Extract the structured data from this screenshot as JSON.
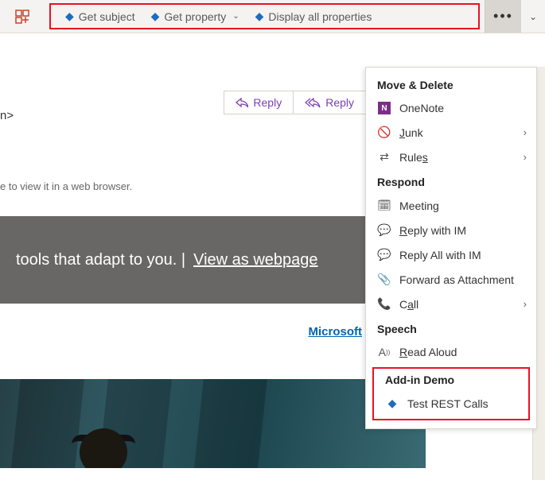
{
  "toolbar": {
    "btn1": "Get subject",
    "btn2": "Get property",
    "btn3": "Display all properties"
  },
  "message": {
    "sender_suffix": "n>",
    "hint": "e to view it in a web browser.",
    "banner_text": "tools that adapt to you. | ",
    "banner_link": "View as webpage",
    "ms_link": "Microsoft"
  },
  "reply": {
    "reply": "Reply",
    "reply_all": "Reply"
  },
  "menu": {
    "h1": "Move & Delete",
    "onenote": "OneNote",
    "junk": "unk",
    "junk_u": "J",
    "rules": "Rule",
    "rules_u": "s",
    "h2": "Respond",
    "meeting": "Meeting",
    "reply_im": "eply with IM",
    "reply_im_u": "R",
    "reply_all_im": "Reply All with IM",
    "forward": "Forward as Attachment",
    "call": "C",
    "call_rest": "ll",
    "call_u": "a",
    "h3": "Speech",
    "read": "ead Aloud",
    "read_u": "R",
    "h4": "Add-in Demo",
    "test": "Test REST Calls"
  }
}
